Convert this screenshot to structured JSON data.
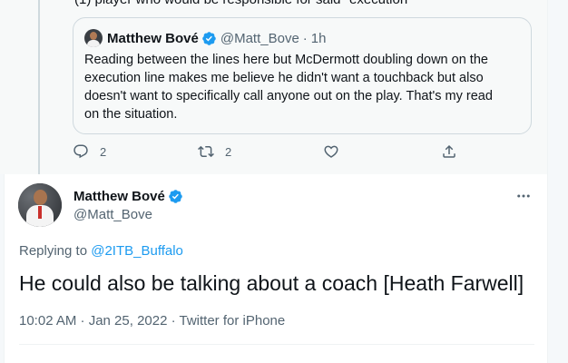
{
  "parent": {
    "cut_text": "(1) player who would be responsible for said \"execution\"",
    "quote": {
      "name": "Matthew Bové",
      "handle": "@Matt_Bove",
      "dot": "·",
      "time": "1h",
      "lines": [
        "Reading between the lines here but McDermott doubling down on the",
        "execution line makes me believe he didn't want a touchback but also",
        "doesn't want to specifically call anyone out on the play. That's my read",
        "on the situation."
      ]
    },
    "actions": {
      "reply_count": "2",
      "retweet_count": "2"
    }
  },
  "tweet": {
    "name": "Matthew Bové",
    "handle": "@Matt_Bove",
    "replying_prefix": "Replying to ",
    "replying_handle": "@2ITB_Buffalo",
    "text": "He could also be talking about a coach [Heath Farwell]",
    "meta": "10:02 AM · Jan 25, 2022 · Twitter for iPhone"
  },
  "icons": {
    "verified": "verified-badge-icon",
    "reply": "reply-icon",
    "retweet": "retweet-icon",
    "like": "like-icon",
    "share": "share-icon",
    "more": "more-icon"
  },
  "colors": {
    "accent": "#1d9bf0",
    "text": "#0f1419",
    "secondary": "#536471",
    "border": "#cfd9de",
    "upper_bg": "#f7f9f9"
  }
}
